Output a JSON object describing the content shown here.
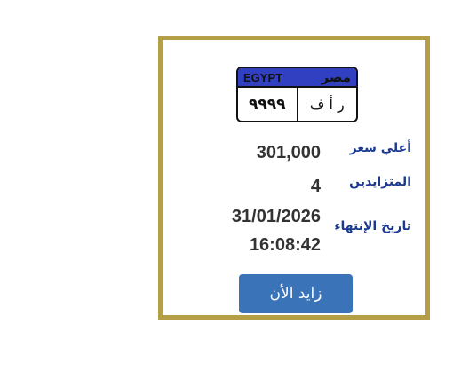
{
  "plate": {
    "country_en": "EGYPT",
    "country_ar": "مصر",
    "letters": "ر أ ف",
    "numbers": "٩٩٩٩",
    "header_color": "#3040c0"
  },
  "details": {
    "highest_price_label": "أعلي سعر",
    "highest_price_value": "301,000",
    "bidders_label": "المتزايدين",
    "bidders_value": "4",
    "end_date_label": "تاريخ الإنتهاء",
    "end_date_value": "31/01/2026",
    "end_time_value": "16:08:42"
  },
  "actions": {
    "bid_label": "زايد الأن"
  },
  "colors": {
    "border": "#b59f46",
    "label": "#1b3a8f",
    "button": "#3b73b9"
  }
}
